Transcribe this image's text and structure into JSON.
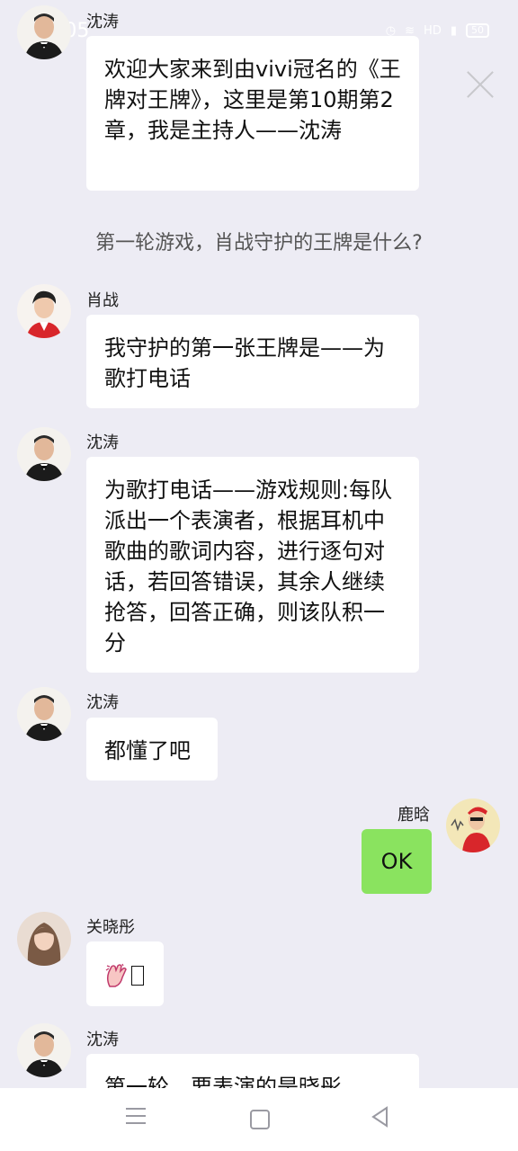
{
  "status_bar": {
    "time": "23:05",
    "signal": "HD",
    "battery": "50"
  },
  "system_message": "第一轮游戏，肖战守护的王牌是什么?",
  "messages": [
    {
      "sender": "沈涛",
      "text": "欢迎大家来到由vivi冠名的《王牌对王牌》，这里是第10期第2章，我是主持人——沈涛"
    },
    {
      "sender": "肖战",
      "text": "我守护的第一张王牌是——为歌打电话"
    },
    {
      "sender": "沈涛",
      "text": "为歌打电话——游戏规则:每队派出一个表演者，根据耳机中歌曲的歌词内容，进行逐句对话，若回答错误，其余人继续抢答，回答正确，则该队积一分"
    },
    {
      "sender": "沈涛",
      "text": "都懂了吧"
    },
    {
      "sender": "鹿晗",
      "text": "OK"
    },
    {
      "sender": "关晓彤",
      "text": ""
    },
    {
      "sender": "沈涛",
      "text": "第一轮，要表演的是晓彤"
    }
  ],
  "colors": {
    "background": "#edecf4",
    "bubble": "#ffffff",
    "self_bubble": "#8ae35f"
  },
  "icons": {
    "close": "close-icon",
    "clap": "clap-emoji-icon",
    "menu": "nav-menu-icon",
    "home": "nav-home-icon",
    "back": "nav-back-icon"
  }
}
